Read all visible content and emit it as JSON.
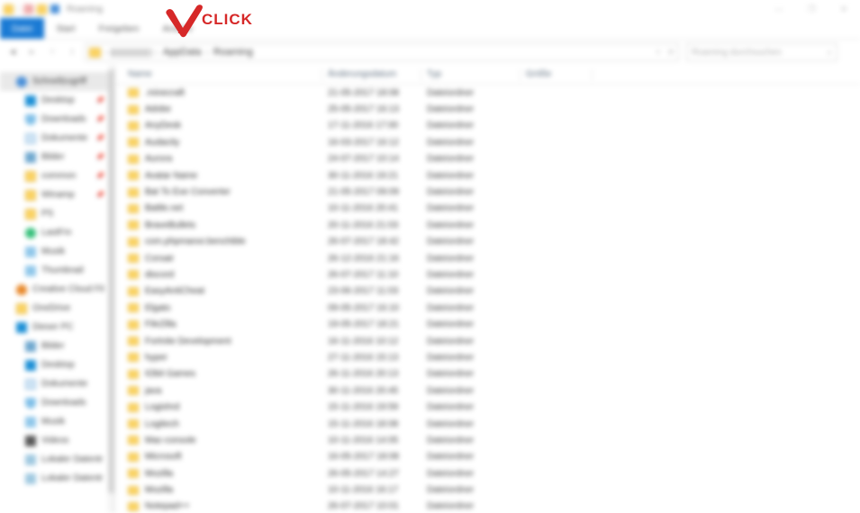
{
  "window": {
    "title": "Roaming",
    "controls": [
      {
        "name": "minimize",
        "glyph": "—"
      },
      {
        "name": "maximize",
        "glyph": "❐"
      },
      {
        "name": "close",
        "glyph": "✕"
      }
    ],
    "quick_access_toolbar": [
      {
        "name": "explorer-icon",
        "kind": "folder"
      },
      {
        "name": "properties-icon",
        "kind": "red"
      },
      {
        "name": "new-folder-icon",
        "kind": "folder"
      },
      {
        "name": "customize-qat-icon",
        "kind": "blue"
      }
    ]
  },
  "ribbon": {
    "tabs": [
      {
        "label": "Datei",
        "active": true
      },
      {
        "label": "Start",
        "active": false
      },
      {
        "label": "Freigeben",
        "active": false
      },
      {
        "label": "Ansicht",
        "active": false
      }
    ]
  },
  "address": {
    "nav_buttons": [
      {
        "name": "back-button",
        "glyph": "◄"
      },
      {
        "name": "forward-button",
        "glyph": "►"
      },
      {
        "name": "recent-locations-button",
        "glyph": "˅"
      },
      {
        "name": "up-button",
        "glyph": "↑"
      }
    ],
    "breadcrumb": {
      "user_segment": "",
      "items": [
        "AppData",
        "Roaming"
      ],
      "separator": "›"
    },
    "refresh_glyph": "⟳",
    "dropdown_glyph": "˅"
  },
  "search": {
    "placeholder": "Roaming durchsuchen",
    "icon": "search-icon",
    "icon_glyph": "⌕"
  },
  "sidebar": {
    "items": [
      {
        "label": "Schnellzugriff",
        "icon": "star",
        "selected": true,
        "indent": false,
        "pinned": false
      },
      {
        "label": "Desktop",
        "icon": "desk",
        "selected": false,
        "indent": true,
        "pinned": true
      },
      {
        "label": "Downloads",
        "icon": "down",
        "selected": false,
        "indent": true,
        "pinned": true
      },
      {
        "label": "Dokumente",
        "icon": "doc",
        "selected": false,
        "indent": true,
        "pinned": true
      },
      {
        "label": "Bilder",
        "icon": "pic",
        "selected": false,
        "indent": true,
        "pinned": true
      },
      {
        "label": "common",
        "icon": "fold",
        "selected": false,
        "indent": true,
        "pinned": true
      },
      {
        "label": "Winamp",
        "icon": "fold",
        "selected": false,
        "indent": true,
        "pinned": true
      },
      {
        "label": "PS",
        "icon": "fold",
        "selected": false,
        "indent": true,
        "pinned": false
      },
      {
        "label": "LastFm",
        "icon": "green",
        "selected": false,
        "indent": true,
        "pinned": false
      },
      {
        "label": "Musik",
        "icon": "music",
        "selected": false,
        "indent": true,
        "pinned": false
      },
      {
        "label": "Thumbnail",
        "icon": "music",
        "selected": false,
        "indent": true,
        "pinned": false
      },
      {
        "label": "Creative Cloud Fil",
        "icon": "cloud",
        "selected": false,
        "indent": false,
        "pinned": false
      },
      {
        "label": "OneDrive",
        "icon": "fold",
        "selected": false,
        "indent": false,
        "pinned": false
      },
      {
        "label": "Dieser PC",
        "icon": "pc",
        "selected": false,
        "indent": false,
        "pinned": false
      },
      {
        "label": "Bilder",
        "icon": "pic",
        "selected": false,
        "indent": true,
        "pinned": false
      },
      {
        "label": "Desktop",
        "icon": "desk",
        "selected": false,
        "indent": true,
        "pinned": false
      },
      {
        "label": "Dokumente",
        "icon": "doc",
        "selected": false,
        "indent": true,
        "pinned": false
      },
      {
        "label": "Downloads",
        "icon": "down",
        "selected": false,
        "indent": true,
        "pinned": false
      },
      {
        "label": "Musik",
        "icon": "music",
        "selected": false,
        "indent": true,
        "pinned": false
      },
      {
        "label": "Videos",
        "icon": "vid",
        "selected": false,
        "indent": true,
        "pinned": false
      },
      {
        "label": "Lokaler Datentr",
        "icon": "drive",
        "selected": false,
        "indent": true,
        "pinned": false
      },
      {
        "label": "Lokaler Datentr",
        "icon": "drive",
        "selected": false,
        "indent": true,
        "pinned": false
      }
    ]
  },
  "filelist": {
    "columns": [
      {
        "label": "Name",
        "key": "name"
      },
      {
        "label": "Änderungsdatum",
        "key": "date"
      },
      {
        "label": "Typ",
        "key": "type"
      },
      {
        "label": "Größe",
        "key": "size"
      }
    ],
    "rows": [
      {
        "name": ".minecraft",
        "date": "21-05-2017 18:08",
        "type": "Dateiordner",
        "size": ""
      },
      {
        "name": "Adobe",
        "date": "25-05-2017 16:13",
        "type": "Dateiordner",
        "size": ""
      },
      {
        "name": "AnyDesk",
        "date": "17-11-2016 17:00",
        "type": "Dateiordner",
        "size": ""
      },
      {
        "name": "Audacity",
        "date": "16-03-2017 16:12",
        "type": "Dateiordner",
        "size": ""
      },
      {
        "name": "Aurora",
        "date": "24-07-2017 10:14",
        "type": "Dateiordner",
        "size": ""
      },
      {
        "name": "Avatar Name",
        "date": "30-11-2016 19:21",
        "type": "Dateiordner",
        "size": ""
      },
      {
        "name": "Bat To Exe Converter",
        "date": "21-05-2017 09:09",
        "type": "Dateiordner",
        "size": ""
      },
      {
        "name": "Battle.net",
        "date": "10-11-2016 20:41",
        "type": "Dateiordner",
        "size": ""
      },
      {
        "name": "BraveBullets",
        "date": "20-11-2016 21:03",
        "type": "Dateiordner",
        "size": ""
      },
      {
        "name": "com.phpmanor.benchible",
        "date": "26-07-2017 18:42",
        "type": "Dateiordner",
        "size": ""
      },
      {
        "name": "Corsair",
        "date": "26-12-2016 21:16",
        "type": "Dateiordner",
        "size": ""
      },
      {
        "name": "discord",
        "date": "26-07-2017 11:10",
        "type": "Dateiordner",
        "size": ""
      },
      {
        "name": "EasyAntiCheat",
        "date": "23-06-2017 11:03",
        "type": "Dateiordner",
        "size": ""
      },
      {
        "name": "Elgato",
        "date": "09-05-2017 16:10",
        "type": "Dateiordner",
        "size": ""
      },
      {
        "name": "FileZilla",
        "date": "19-05-2017 18:21",
        "type": "Dateiordner",
        "size": ""
      },
      {
        "name": "Fortnite Development",
        "date": "16-11-2016 10:12",
        "type": "Dateiordner",
        "size": ""
      },
      {
        "name": "hyper",
        "date": "27-11-2016 15:13",
        "type": "Dateiordner",
        "size": ""
      },
      {
        "name": "IObit Games",
        "date": "26-11-2016 20:13",
        "type": "Dateiordner",
        "size": ""
      },
      {
        "name": "java",
        "date": "30-11-2016 20:45",
        "type": "Dateiordner",
        "size": ""
      },
      {
        "name": "Logishrd",
        "date": "15-11-2016 19:59",
        "type": "Dateiordner",
        "size": ""
      },
      {
        "name": "Logitech",
        "date": "15-11-2016 18:08",
        "type": "Dateiordner",
        "size": ""
      },
      {
        "name": "Mac-console",
        "date": "10-11-2016 14:05",
        "type": "Dateiordner",
        "size": ""
      },
      {
        "name": "Microsoft",
        "date": "16-05-2017 18:08",
        "type": "Dateiordner",
        "size": ""
      },
      {
        "name": "Mozilla",
        "date": "26-05-2017 14:27",
        "type": "Dateiordner",
        "size": ""
      },
      {
        "name": "Mozilla",
        "date": "10-11-2016 16:17",
        "type": "Dateiordner",
        "size": ""
      },
      {
        "name": "Notepad++",
        "date": "26-07-2017 10:01",
        "type": "Dateiordner",
        "size": ""
      }
    ]
  },
  "annotation": {
    "label": "CLICK",
    "color": "#d62828",
    "icon": "check-arrow-annotation"
  }
}
